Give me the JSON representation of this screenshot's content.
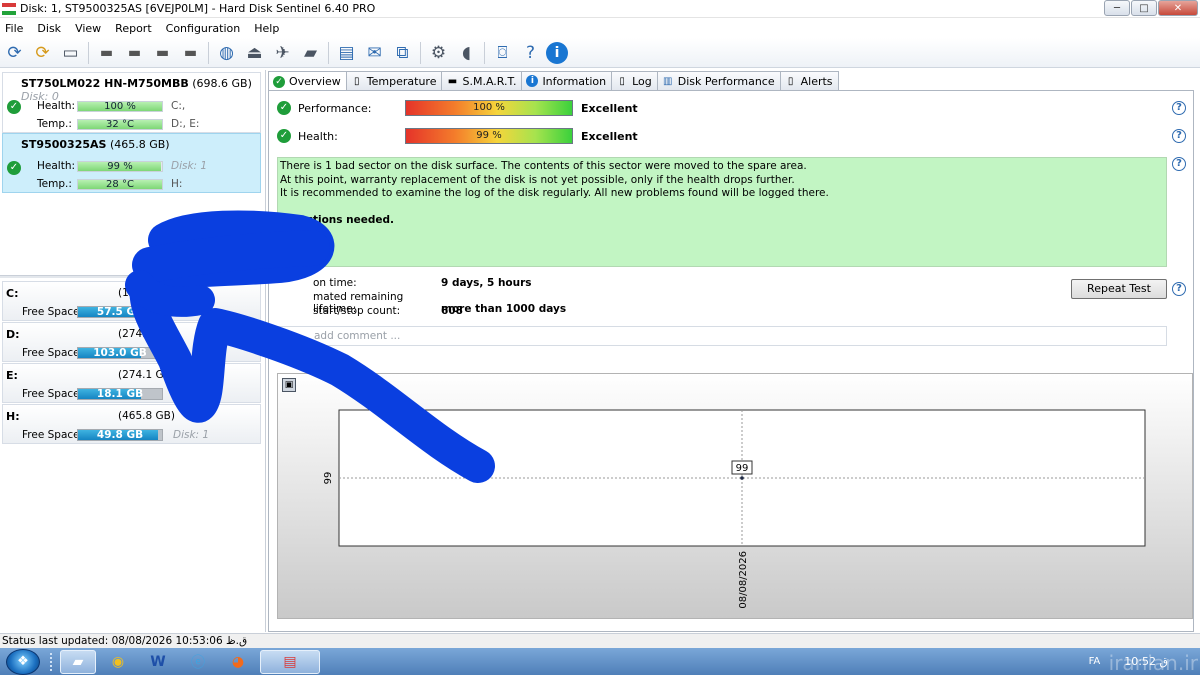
{
  "window": {
    "title": "Disk: 1, ST9500325AS [6VEJP0LM]  -  Hard Disk Sentinel 6.40 PRO",
    "controls": [
      "─",
      "□",
      "✕"
    ]
  },
  "menu": [
    "File",
    "Disk",
    "View",
    "Report",
    "Configuration",
    "Help"
  ],
  "toolbar_icons": [
    "refresh-icon",
    "refresh-warning-icon",
    "disk-info-icon",
    "drive-icon",
    "drive-clock-icon",
    "drive-check-icon",
    "drive-test-icon",
    "globe-drive-icon",
    "eject-icon",
    "satellite-icon",
    "usb-drive-icon",
    "notes-icon",
    "mail-icon",
    "network-icon",
    "settings-icon",
    "sound-icon",
    "camera-icon",
    "help-icon",
    "info-icon"
  ],
  "disks": [
    {
      "name": "ST750LM022 HN-M750MBB",
      "size": "(698.6 GB)",
      "disk_label": "Disk: 0",
      "health_label": "Health:",
      "health": "100 %",
      "health_pct": 100,
      "temp_label": "Temp.:",
      "temp": "32 °C",
      "temp_pct": 100,
      "side1": "C:,",
      "side2": "D:, E:"
    },
    {
      "name": "ST9500325AS",
      "size": "(465.8 GB)",
      "disk_label": "Disk: 1",
      "health_label": "Health:",
      "health": "99 %",
      "health_pct": 99,
      "temp_label": "Temp.:",
      "temp": "28 °C",
      "temp_pct": 100,
      "side1": "Disk: 1",
      "side2": "H:"
    }
  ],
  "partitions": [
    {
      "letter": "C:",
      "size": "(15",
      "label": "Free Space",
      "free": "57.5 GB",
      "free_pct": 0.75,
      "disk": ""
    },
    {
      "letter": "D:",
      "size": "(274.1 GB)",
      "label": "Free Space",
      "free": "103.0 GB",
      "free_pct": 0.75,
      "disk": ""
    },
    {
      "letter": "E:",
      "size": "(274.1 GB)",
      "label": "Free Space",
      "free": "18.1 GB",
      "free_pct": 0.75,
      "disk": ""
    },
    {
      "letter": "H:",
      "size": "(465.8 GB)",
      "label": "Free Space",
      "free": "49.8 GB",
      "free_pct": 0.95,
      "disk": "Disk: 1"
    }
  ],
  "tabs": [
    {
      "label": "Overview",
      "icon": "check-icon",
      "active": true
    },
    {
      "label": "Temperature",
      "icon": "thermometer-icon",
      "active": false
    },
    {
      "label": "S.M.A.R.T.",
      "icon": "dash-icon",
      "active": false
    },
    {
      "label": "Information",
      "icon": "info-icon",
      "active": false
    },
    {
      "label": "Log",
      "icon": "document-icon",
      "active": false
    },
    {
      "label": "Disk Performance",
      "icon": "chart-icon",
      "active": false
    },
    {
      "label": "Alerts",
      "icon": "alert-document-icon",
      "active": false
    }
  ],
  "overview": {
    "performance_label": "Performance:",
    "performance": "100 %",
    "performance_rating": "Excellent",
    "health_label": "Health:",
    "health": "99 %",
    "health_rating": "Excellent",
    "message_lines": [
      "There is 1 bad sector on the disk surface. The contents of this sector were moved to the spare area.",
      "At this point, warranty replacement of the disk is not yet possible, only if the health drops further.",
      "It is recommended to examine the log of the disk regularly. All new problems found will be logged there."
    ],
    "message_action": "No actions needed.",
    "power_on_label": "on time:",
    "power_on": "9 days, 5 hours",
    "lifetime_label": "mated remaining lifetime:",
    "lifetime": "more than 1000 days",
    "startstop_label": "start/stop count:",
    "startstop": "608",
    "repeat_button": "Repeat Test",
    "comment_placeholder": "add comment ..."
  },
  "chart_data": {
    "type": "line",
    "title": "",
    "xlabel": "",
    "ylabel": "",
    "x": [
      "08/08/2026"
    ],
    "series": [
      {
        "values": [
          99
        ]
      }
    ],
    "y_tick_labels": [
      "99"
    ],
    "data_labels": [
      "99"
    ],
    "grid": true
  },
  "status": {
    "text": "Status last updated: 08/08/2026 10:53:06 ق.ظ"
  },
  "taskbar": {
    "apps": [
      "explorer-icon",
      "chrome-icon",
      "word-icon",
      "edge-icon",
      "firefox-icon",
      "hdsentinel-icon"
    ],
    "lang": "FA",
    "clock": "10:52 ق"
  },
  "colors": {
    "accent_green": "#1f9d3a",
    "message_bg": "#c2f5c3",
    "scribble": "#0a3fe0",
    "free_space_bar": "#1585c2"
  },
  "watermark": "iranian.ir"
}
